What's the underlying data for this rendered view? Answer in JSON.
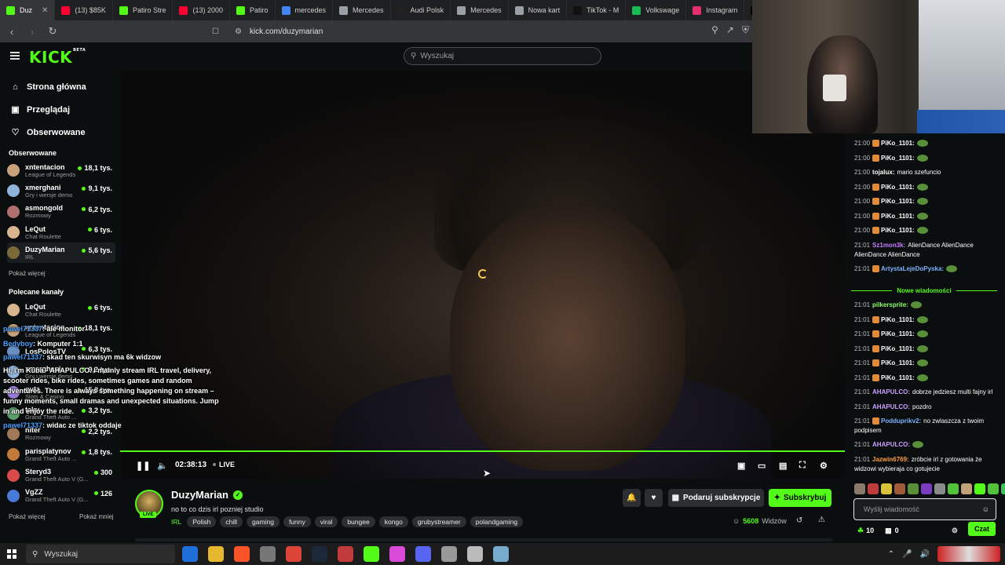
{
  "browser": {
    "tabs": [
      {
        "label": "Duz",
        "active": true,
        "color": "#53fc18"
      },
      {
        "label": "(13) $85K",
        "active": false,
        "color": "#ff0033"
      },
      {
        "label": "Patiro Stre",
        "active": false,
        "color": "#53fc18"
      },
      {
        "label": "(13) 2000",
        "active": false,
        "color": "#ff0033"
      },
      {
        "label": "Patiro",
        "active": false,
        "color": "#53fc18"
      },
      {
        "label": "mercedes",
        "active": false,
        "color": "#4285f4"
      },
      {
        "label": "Mercedes",
        "active": false,
        "color": "#9aa0a6"
      },
      {
        "label": "Audi Polsk",
        "active": false,
        "color": "#222222"
      },
      {
        "label": "Mercedes",
        "active": false,
        "color": "#9aa0a6"
      },
      {
        "label": "Nowa kart",
        "active": false,
        "color": "#9aa0a6"
      },
      {
        "label": "TikTok - M",
        "active": false,
        "color": "#111111"
      },
      {
        "label": "Volkswage",
        "active": false,
        "color": "#1db954"
      },
      {
        "label": "Instagram",
        "active": false,
        "color": "#e1306c"
      },
      {
        "label": "(5",
        "active": false,
        "color": "#000000"
      }
    ],
    "url": "kick.com/duzymarian"
  },
  "kick": {
    "logo": "KICK",
    "logo_badge": "BETA",
    "search_placeholder": "Wyszukaj"
  },
  "sidebar": {
    "nav": [
      {
        "label": "Strona główna",
        "icon": "home-icon",
        "glyph": "⌂"
      },
      {
        "label": "Przeglądaj",
        "icon": "browse-icon",
        "glyph": "▣"
      },
      {
        "label": "Obserwowane",
        "icon": "heart-icon",
        "glyph": "♡"
      }
    ],
    "followed_title": "Obserwowane",
    "followed": [
      {
        "name": "xntentacion",
        "game": "League of Legends",
        "viewers": "18,1 tys.",
        "color": "#c7a17a"
      },
      {
        "name": "xmerghani",
        "game": "Gry i wersje demo",
        "viewers": "9,1 tys.",
        "color": "#8fb3d9"
      },
      {
        "name": "asmongold",
        "game": "Rozmowy",
        "viewers": "6,2 tys.",
        "color": "#b07070"
      },
      {
        "name": "LeQut",
        "game": "Chat Roulette",
        "viewers": "6 tys.",
        "color": "#d9b58f"
      },
      {
        "name": "DuzyMarian",
        "game": "IRL",
        "viewers": "5,6 tys.",
        "color": "#7a6a3a"
      }
    ],
    "followed_more": "Pokaż więcej",
    "recommended_title": "Polecane kanały",
    "recommended": [
      {
        "name": "LeQut",
        "game": "Chat Roulette",
        "viewers": "6 tys.",
        "color": "#d9b58f"
      },
      {
        "name": "xntentacion",
        "game": "League of Legends",
        "viewers": "18,1 tys.",
        "color": "#c7a17a"
      },
      {
        "name": "LosPolosTV",
        "game": "",
        "viewers": "6,3 tys.",
        "color": "#6a8fc2"
      },
      {
        "name": "xmerghani",
        "game": "Gry i wersje demo",
        "viewers": "9,2 tys.",
        "color": "#8fb3d9"
      },
      {
        "name": "gutz",
        "game": "Slots & Casino",
        "viewers": "15,8 tys.",
        "color": "#9a7ad9"
      },
      {
        "name": "taku",
        "game": "Grand Theft Auto ...",
        "viewers": "3,2 tys.",
        "color": "#5a9f6a"
      },
      {
        "name": "niter",
        "game": "Rozmowy",
        "viewers": "2,2 tys.",
        "color": "#a07a5a"
      },
      {
        "name": "parisplatynov",
        "game": "Grand Theft Auto ...",
        "viewers": "1,8 tys.",
        "color": "#c27a3a"
      },
      {
        "name": "Steryd3",
        "game": "Grand Theft Auto V (G...",
        "viewers": "300",
        "color": "#d94a4a"
      },
      {
        "name": "VgZZ",
        "game": "Grand Theft Auto V (G...",
        "viewers": "126",
        "color": "#4a7ad9"
      }
    ],
    "rec_more": "Pokaż więcej",
    "rec_less": "Pokaż mniej"
  },
  "overlay": {
    "lines": [
      {
        "user": "pawel71337",
        "text": "ale monitor"
      },
      {
        "user": "Bedyboy",
        "text": "Komputer 1:1"
      },
      {
        "user": "pawel71337",
        "text": "skad ten skurwisyn ma 6k widzow"
      },
      {
        "user": "",
        "text": "Hi, I'm Kuba - AHAPULCO. I mainly stream IRL travel, delivery, scooter rides, bike rides, sometimes games and random adventures. There is always something happening on stream – funny moments, small dramas and unexpected situations. Jump in and enjoy the ride."
      },
      {
        "user": "pawel71337",
        "text": "widac ze tiktok oddaje"
      }
    ]
  },
  "player": {
    "time": "02:38:13",
    "live": "LIVE"
  },
  "stream": {
    "channel": "DuzyMarian",
    "live_badge": "LIVE",
    "title": "no to co dzis irl pozniej studio",
    "category": "IRL",
    "tags": [
      "Polish",
      "chill",
      "gaming",
      "funny",
      "viral",
      "bungee",
      "kongo",
      "grubystreamer",
      "polandgaming"
    ],
    "gift_label": "Podaruj subskrypcje",
    "subscribe_label": "Subskrybuj",
    "viewers": "5608",
    "viewers_label": "Widzów"
  },
  "chat": {
    "messages": [
      {
        "time": "21:00",
        "user": "PiKo_1101:",
        "text": "",
        "color": "#ffffff",
        "emote": true,
        "badge": true
      },
      {
        "time": "21:00",
        "user": "PiKo_1101:",
        "text": "",
        "color": "#ffffff",
        "emote": true,
        "badge": true
      },
      {
        "time": "21:00",
        "user": "tojalux:",
        "text": "mario szefuncio",
        "color": "#ffffff",
        "emote": false,
        "badge": false
      },
      {
        "time": "21:00",
        "user": "PiKo_1101:",
        "text": "",
        "color": "#ffffff",
        "emote": true,
        "badge": true
      },
      {
        "time": "21:00",
        "user": "PiKo_1101:",
        "text": "",
        "color": "#ffffff",
        "emote": true,
        "badge": true
      },
      {
        "time": "21:00",
        "user": "PiKo_1101:",
        "text": "",
        "color": "#ffffff",
        "emote": true,
        "badge": true
      },
      {
        "time": "21:00",
        "user": "PiKo_1101:",
        "text": "",
        "color": "#ffffff",
        "emote": true,
        "badge": true
      },
      {
        "time": "21:01",
        "user": "Sz1mon3k:",
        "text": "AlienDance AlienDance AlienDance AlienDance",
        "color": "#c77dff",
        "emote": false,
        "badge": false,
        "wrap": true
      },
      {
        "time": "21:01",
        "user": "ArtystaLejeDoPyska:",
        "text": "",
        "color": "#7fb2ff",
        "emote": true,
        "badge": true
      }
    ],
    "new_messages_label": "Nowe wiadomości",
    "messages2": [
      {
        "time": "21:01",
        "user": "pilkersprite:",
        "text": "",
        "color": "#8cff6a",
        "emote": true,
        "badge": false
      },
      {
        "time": "21:01",
        "user": "PiKo_1101:",
        "text": "",
        "color": "#ffffff",
        "emote": true,
        "badge": true
      },
      {
        "time": "21:01",
        "user": "PiKo_1101:",
        "text": "",
        "color": "#ffffff",
        "emote": true,
        "badge": true
      },
      {
        "time": "21:01",
        "user": "PiKo_1101:",
        "text": "",
        "color": "#ffffff",
        "emote": true,
        "badge": true
      },
      {
        "time": "21:01",
        "user": "PiKo_1101:",
        "text": "",
        "color": "#ffffff",
        "emote": true,
        "badge": true
      },
      {
        "time": "21:01",
        "user": "PiKo_1101:",
        "text": "",
        "color": "#ffffff",
        "emote": true,
        "badge": true
      },
      {
        "time": "21:01",
        "user": "AHAPULCO:",
        "text": "dobrze jedziesz multi fajny irl",
        "color": "#c9a0ff",
        "emote": false,
        "badge": false
      },
      {
        "time": "21:01",
        "user": "AHAPULCO:",
        "text": "pozdro",
        "color": "#c9a0ff",
        "emote": false,
        "badge": false
      },
      {
        "time": "21:01",
        "user": "Podduprikv2:",
        "text": "no zwlaszcza z twoim podpisem",
        "color": "#7fb2ff",
        "emote": false,
        "badge": true,
        "wrap": true
      },
      {
        "time": "21:01",
        "user": "AHAPULCO:",
        "text": "",
        "color": "#c9a0ff",
        "emote": true,
        "badge": false
      },
      {
        "time": "21:01",
        "user": "Jazwin6769:",
        "text": "zróbcie irl z gotowania że widzowi wybieraja co gotujecie",
        "color": "#ff9f43",
        "emote": false,
        "badge": false,
        "wrap": true
      }
    ],
    "input_placeholder": "Wyślij wiadomość",
    "points": "10",
    "gifts": "0",
    "send_label": "Czat"
  },
  "taskbar": {
    "search": "Wyszukaj"
  }
}
